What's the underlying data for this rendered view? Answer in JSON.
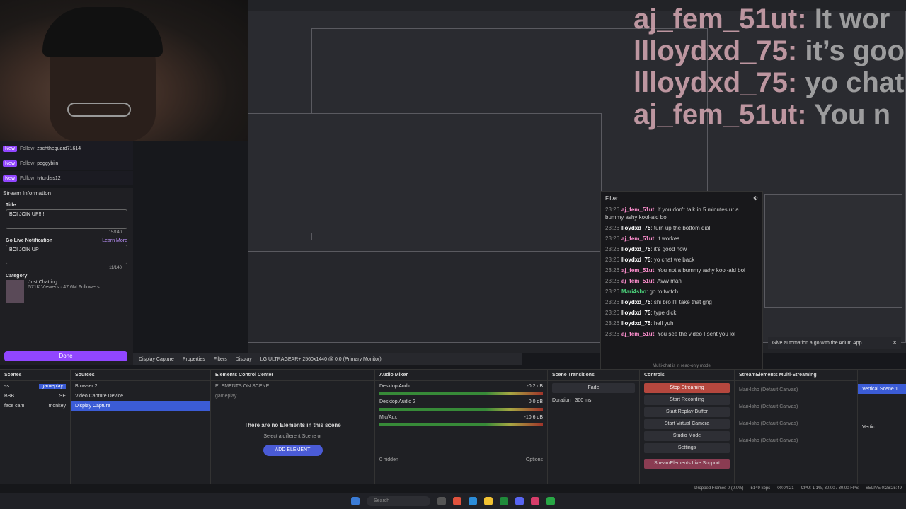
{
  "alerts": [
    {
      "badge": "New",
      "action": "Follow",
      "user": "zachtheguard71614"
    },
    {
      "badge": "New",
      "action": "Follow",
      "user": "peggybiln"
    },
    {
      "badge": "New",
      "action": "Follow",
      "user": "tvtcrdiss12"
    }
  ],
  "stream_info": {
    "header": "Stream Information",
    "title_label": "Title",
    "title_value": "BOI JOIN UP!!!!",
    "title_count": "15/140",
    "notif_label": "Go Live Notification",
    "learn_more": "Learn More",
    "notif_value": "BOI JOIN UP",
    "notif_count": "11/140",
    "category_label": "Category",
    "category_name": "Just Chatting",
    "category_stats": "571K Viewers · 47.6M Followers",
    "done": "Done"
  },
  "overlay_chat": [
    {
      "user": "aj_fem_51ut:",
      "msg": "It wor"
    },
    {
      "user": "llloydxd_75:",
      "msg": "it’s goo"
    },
    {
      "user": "llloydxd_75:",
      "msg": "yo chat"
    },
    {
      "user": "aj_fem_51ut:",
      "msg": "You n"
    }
  ],
  "chat": {
    "filter": "Filter",
    "messages": [
      {
        "time": "23:26",
        "user": "aj_fem_51ut",
        "color": "#ff8fcf",
        "msg": "If you don't talk in 5 minutes ur a bummy ashy kool-aid boi"
      },
      {
        "time": "23:26",
        "user": "lloydxd_75",
        "color": "#ffffff",
        "msg": "turn up the bottom dial"
      },
      {
        "time": "23:26",
        "user": "aj_fem_51ut",
        "color": "#ff8fcf",
        "msg": "it workes"
      },
      {
        "time": "23:26",
        "user": "lloydxd_75",
        "color": "#ffffff",
        "msg": "it's good now"
      },
      {
        "time": "23:26",
        "user": "lloydxd_75",
        "color": "#ffffff",
        "msg": "yo chat we back"
      },
      {
        "time": "23:26",
        "user": "aj_fem_51ut",
        "color": "#ff8fcf",
        "msg": "You not a bummy ashy kool-aid boi"
      },
      {
        "time": "23:26",
        "user": "aj_fem_51ut",
        "color": "#ff8fcf",
        "msg": "Aww man"
      },
      {
        "time": "23:26",
        "user": "Mari4sho",
        "color": "#4bd07a",
        "msg": "go to twitch"
      },
      {
        "time": "23:26",
        "user": "lloydxd_75",
        "color": "#ffffff",
        "msg": "shi bro I'll take that gng"
      },
      {
        "time": "23:26",
        "user": "lloydxd_75",
        "color": "#ffffff",
        "msg": "type dick"
      },
      {
        "time": "23:26",
        "user": "lloydxd_75",
        "color": "#ffffff",
        "msg": "hell yuh"
      },
      {
        "time": "23:26",
        "user": "aj_fem_51ut",
        "color": "#ff8fcf",
        "msg": "You see the video I sent you lol"
      }
    ],
    "readonly": "Multi-chat is in read-only mode"
  },
  "ad": {
    "text": "Give automation a go with the Arlum App"
  },
  "toolbar": {
    "source": "Display Capture",
    "properties": "Properties",
    "filters": "Filters",
    "display_label": "Display",
    "display_value": "LG ULTRAGEAR+ 2560x1440 @ 0,0 (Primary Monitor)"
  },
  "scenes": {
    "title": "Scenes",
    "items": [
      "ss",
      "BBB",
      "face cam"
    ],
    "alt": [
      "gameplay",
      "SE",
      "monkey"
    ]
  },
  "sources": {
    "title": "Sources",
    "items": [
      "Browser 2",
      "Video Capture Device",
      "Display Capture"
    ]
  },
  "elements": {
    "title": "Elements Control Center",
    "sub": "ELEMENTS ON SCENE",
    "scene": "gameplay",
    "empty": "There are no Elements in this scene",
    "hint": "Select a different Scene or",
    "add": "ADD ELEMENT",
    "add2": "ADD ELEMENT"
  },
  "mixer": {
    "title": "Audio Mixer",
    "channels": [
      {
        "name": "Desktop Audio",
        "db": "-0.2 dB"
      },
      {
        "name": "Desktop Audio 2",
        "db": "0.0 dB"
      },
      {
        "name": "Mic/Aux",
        "db": "-10.6 dB"
      }
    ],
    "hidden": "0 hidden",
    "options": "Options"
  },
  "transitions": {
    "title": "Scene Transitions",
    "type": "Fade",
    "duration_label": "Duration",
    "duration": "300 ms"
  },
  "controls": {
    "title": "Controls",
    "stop": "Stop Streaming",
    "rec": "Start Recording",
    "replay": "Start Replay Buffer",
    "vcam": "Start Virtual Camera",
    "studio": "Studio Mode",
    "settings": "Settings",
    "se": "StreamElements Live Support"
  },
  "multi": {
    "title": "StreamElements Multi-Streaming",
    "items": [
      "Mari4sho (Default Canvas)",
      "Mari4sho (Default Canvas)",
      "Mari4sho (Default Canvas)",
      "Mari4sho (Default Canvas)"
    ]
  },
  "vertical": {
    "scene": "Vertical Scene 1",
    "label": "Vertic..."
  },
  "status": {
    "dropped": "Dropped Frames 0 (0.0%)",
    "kbps": "5149 kbps",
    "time": "00:04:21",
    "cpu": "CPU: 1.1%, 30.00 / 30.00 FPS",
    "se": "SELIVE 0:26:25:49"
  },
  "taskbar": {
    "search": "Search"
  }
}
